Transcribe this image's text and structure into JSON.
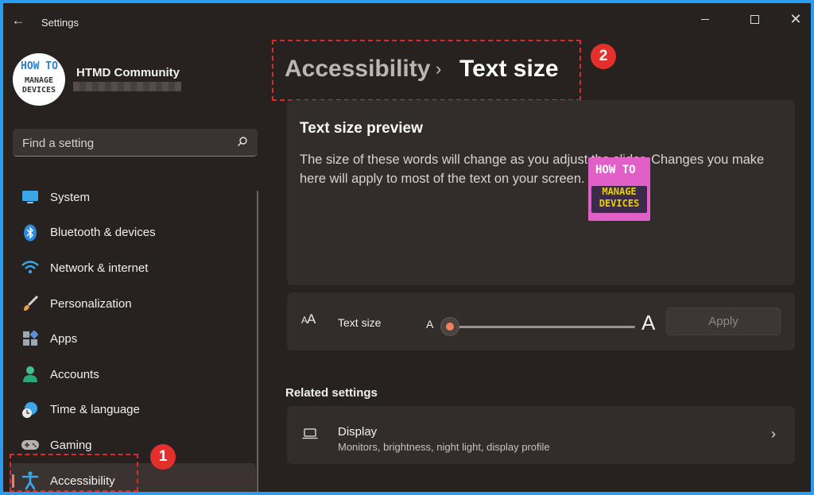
{
  "window": {
    "title": "Settings",
    "controls": [
      "minimize",
      "maximize",
      "close"
    ]
  },
  "profile": {
    "name": "HTMD Community",
    "avatar_logo": "HOW TO MANAGE DEVICES"
  },
  "search": {
    "placeholder": "Find a setting",
    "icon": "search-icon"
  },
  "sidebar": {
    "items": [
      {
        "label": "System",
        "icon": "monitor-icon",
        "active": false
      },
      {
        "label": "Bluetooth & devices",
        "icon": "bluetooth-icon",
        "active": false
      },
      {
        "label": "Network & internet",
        "icon": "wifi-icon",
        "active": false
      },
      {
        "label": "Personalization",
        "icon": "brush-icon",
        "active": false
      },
      {
        "label": "Apps",
        "icon": "apps-icon",
        "active": false
      },
      {
        "label": "Accounts",
        "icon": "person-icon",
        "active": false
      },
      {
        "label": "Time & language",
        "icon": "globe-clock-icon",
        "active": false
      },
      {
        "label": "Gaming",
        "icon": "gamepad-icon",
        "active": false
      },
      {
        "label": "Accessibility",
        "icon": "accessibility-icon",
        "active": true
      }
    ]
  },
  "breadcrumb": {
    "parent": "Accessibility",
    "separator": "›",
    "current": "Text size"
  },
  "preview": {
    "title": "Text size preview",
    "text": "The size of these words will change as you adjust the slider. Changes you make here will apply to most of the text on your screen."
  },
  "text_size_setting": {
    "label": "Text size",
    "icon": "text-size-icon",
    "min_label": "A",
    "max_label": "A",
    "slider_value_percent": 100,
    "apply_label": "Apply"
  },
  "related": {
    "heading": "Related settings",
    "display": {
      "title": "Display",
      "subtitle": "Monitors, brightness, night light, display profile",
      "icon": "laptop-icon"
    }
  },
  "annotations": {
    "callout_1": "1",
    "callout_2": "2",
    "color": "#e4302d"
  },
  "watermark": {
    "line1": "HOW TO",
    "line2": "MANAGE",
    "line3": "DEVICES"
  },
  "colors": {
    "accent": "#f08262",
    "background": "#272220",
    "card": "#322c2a",
    "frame": "#2b9bf0"
  }
}
